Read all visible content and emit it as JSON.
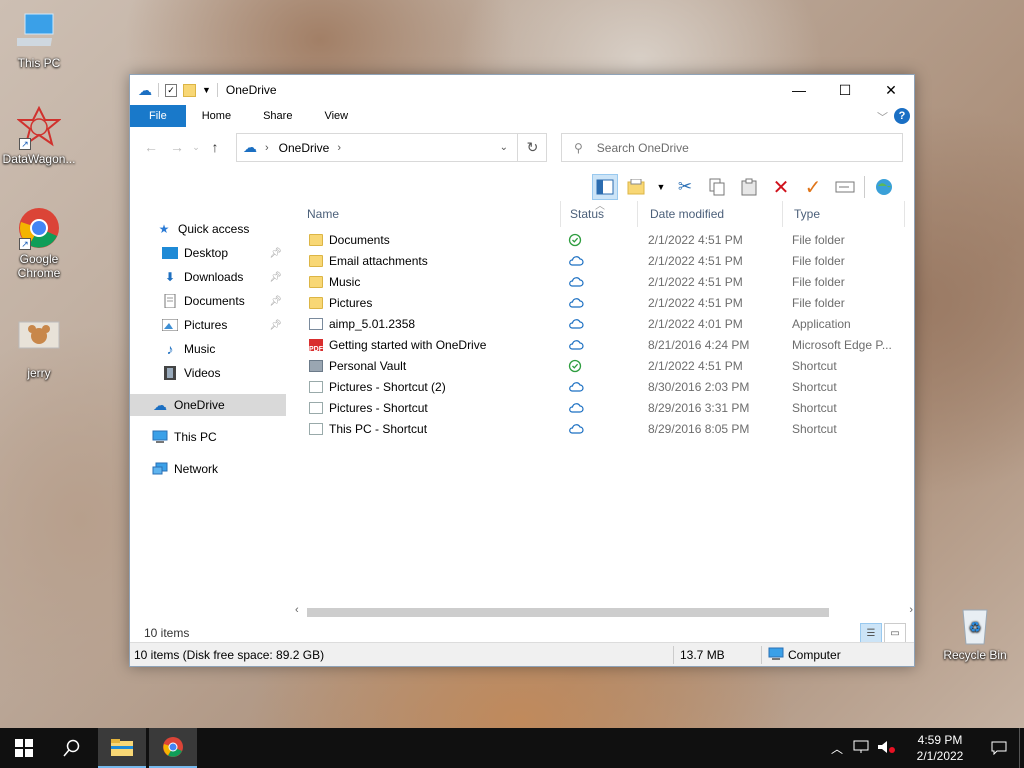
{
  "desktop": {
    "icons": [
      {
        "label": "This PC"
      },
      {
        "label": "DataWagon..."
      },
      {
        "label": "Google Chrome"
      },
      {
        "label": "jerry"
      },
      {
        "label": "Recycle Bin"
      }
    ]
  },
  "window": {
    "title": "OneDrive",
    "tabs": [
      "File",
      "Home",
      "Share",
      "View"
    ],
    "help_label": "?",
    "address": {
      "crumb": "OneDrive"
    },
    "search": {
      "placeholder": "Search OneDrive"
    }
  },
  "navpane": {
    "items": [
      {
        "label": "Quick access",
        "icon": "star-icon"
      },
      {
        "label": "Desktop",
        "icon": "desktop-folder-icon",
        "pinned": true
      },
      {
        "label": "Downloads",
        "icon": "download-arrow-icon",
        "pinned": true
      },
      {
        "label": "Documents",
        "icon": "documents-icon",
        "pinned": true
      },
      {
        "label": "Pictures",
        "icon": "pictures-icon",
        "pinned": true
      },
      {
        "label": "Music",
        "icon": "music-note-icon"
      },
      {
        "label": "Videos",
        "icon": "film-icon"
      },
      {
        "label": "OneDrive",
        "icon": "cloud-icon"
      },
      {
        "label": "This PC",
        "icon": "computer-icon"
      },
      {
        "label": "Network",
        "icon": "network-icon"
      }
    ]
  },
  "columns": {
    "name": "Name",
    "status": "Status",
    "date": "Date modified",
    "type": "Type"
  },
  "files": [
    {
      "name": "Documents",
      "status": "synced",
      "date": "2/1/2022 4:51 PM",
      "type": "File folder",
      "icon": "folder-icon"
    },
    {
      "name": "Email attachments",
      "status": "cloud",
      "date": "2/1/2022 4:51 PM",
      "type": "File folder",
      "icon": "folder-icon"
    },
    {
      "name": "Music",
      "status": "cloud",
      "date": "2/1/2022 4:51 PM",
      "type": "File folder",
      "icon": "folder-icon"
    },
    {
      "name": "Pictures",
      "status": "cloud",
      "date": "2/1/2022 4:51 PM",
      "type": "File folder",
      "icon": "folder-icon"
    },
    {
      "name": "aimp_5.01.2358",
      "status": "cloud",
      "date": "2/1/2022 4:01 PM",
      "type": "Application",
      "icon": "application-icon"
    },
    {
      "name": "Getting started with OneDrive",
      "status": "cloud",
      "date": "8/21/2016 4:24 PM",
      "type": "Microsoft Edge P...",
      "icon": "pdf-icon"
    },
    {
      "name": "Personal Vault",
      "status": "synced",
      "date": "2/1/2022 4:51 PM",
      "type": "Shortcut",
      "icon": "vault-icon"
    },
    {
      "name": "Pictures - Shortcut (2)",
      "status": "cloud",
      "date": "8/30/2016 2:03 PM",
      "type": "Shortcut",
      "icon": "shortcut-icon"
    },
    {
      "name": "Pictures - Shortcut",
      "status": "cloud",
      "date": "8/29/2016 3:31 PM",
      "type": "Shortcut",
      "icon": "shortcut-icon"
    },
    {
      "name": "This PC - Shortcut",
      "status": "cloud",
      "date": "8/29/2016 8:05 PM",
      "type": "Shortcut",
      "icon": "shortcut-icon"
    }
  ],
  "item_count": "10 items",
  "statusbar": {
    "left": "10 items (Disk free space: 89.2 GB)",
    "size": "13.7 MB",
    "location": "Computer"
  },
  "taskbar": {
    "time": "4:59 PM",
    "date": "2/1/2022"
  },
  "colors": {
    "accent": "#1979ca",
    "synced": "#2e9d3f",
    "cloud": "#1b6fc2",
    "folder": "#f8d775"
  }
}
